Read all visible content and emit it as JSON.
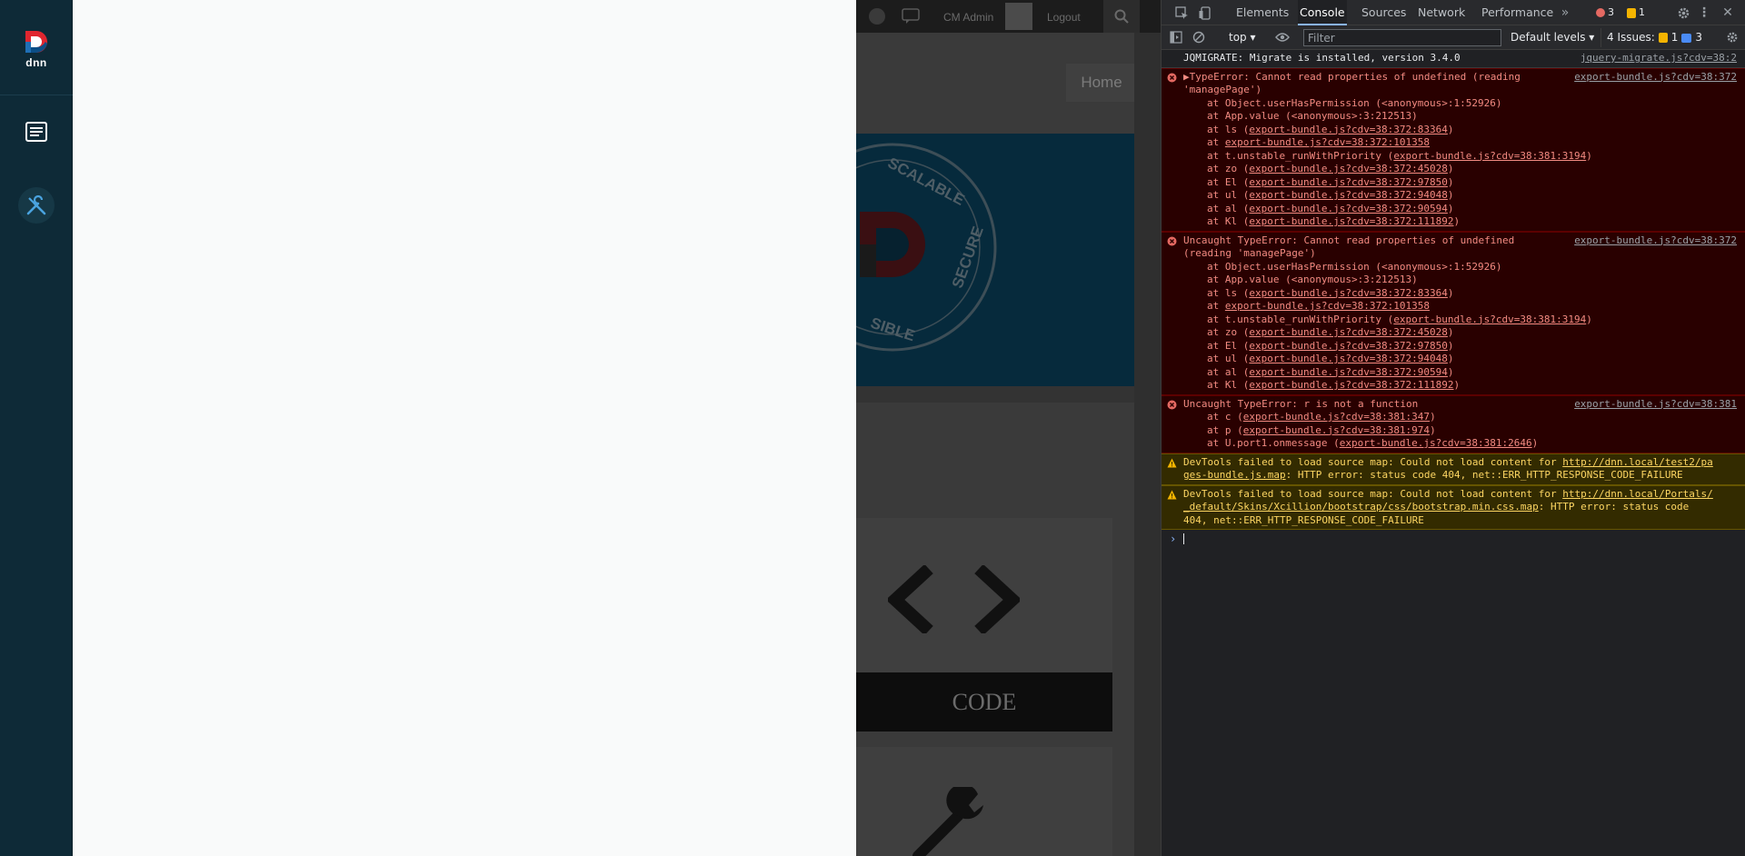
{
  "persona_bar": {
    "logo_text": "dnn",
    "items": [
      {
        "name": "content",
        "icon": "content-list-icon"
      },
      {
        "name": "tools",
        "icon": "wrench-screwdriver-icon"
      }
    ]
  },
  "site": {
    "topbar": {
      "user_label": "CM Admin",
      "logout_label": "Logout"
    },
    "home_label": "Home",
    "hero_words": [
      "SCALABLE",
      "SECURE",
      "SIBLE"
    ],
    "card_label": "CODE"
  },
  "devtools": {
    "tabs": [
      "Elements",
      "Console",
      "Sources",
      "Network",
      "Performance"
    ],
    "active_tab": "Console",
    "error_count": "3",
    "warning_count": "1",
    "toolbar": {
      "context": "top",
      "filter_placeholder": "Filter",
      "levels": "Default levels",
      "issues_label": "4 Issues:",
      "issues_warn": "1",
      "issues_info": "3"
    },
    "messages": [
      {
        "level": "log",
        "text": "JQMIGRATE: Migrate is installed, version 3.4.0",
        "source": "jquery-migrate.js?cdv=38:2"
      },
      {
        "level": "error",
        "text": "▶TypeError: Cannot read properties of undefined (reading\n'managePage')",
        "source": "export-bundle.js?cdv=38:372",
        "frames": [
          {
            "pre": "at Object.userHasPermission (<anonymous>:1:52926)",
            "link": ""
          },
          {
            "pre": "at App.value (<anonymous>:3:212513)",
            "link": ""
          },
          {
            "pre": "at ls (",
            "link": "export-bundle.js?cdv=38:372:83364",
            "post": ")"
          },
          {
            "pre": "at ",
            "link": "export-bundle.js?cdv=38:372:101358",
            "post": ""
          },
          {
            "pre": "at t.unstable_runWithPriority (",
            "link": "export-bundle.js?cdv=38:381:3194",
            "post": ")"
          },
          {
            "pre": "at zo (",
            "link": "export-bundle.js?cdv=38:372:45028",
            "post": ")"
          },
          {
            "pre": "at El (",
            "link": "export-bundle.js?cdv=38:372:97850",
            "post": ")"
          },
          {
            "pre": "at ul (",
            "link": "export-bundle.js?cdv=38:372:94048",
            "post": ")"
          },
          {
            "pre": "at al (",
            "link": "export-bundle.js?cdv=38:372:90594",
            "post": ")"
          },
          {
            "pre": "at Kl (",
            "link": "export-bundle.js?cdv=38:372:111892",
            "post": ")"
          }
        ]
      },
      {
        "level": "error",
        "text": "Uncaught TypeError: Cannot read properties of undefined\n(reading 'managePage')",
        "source": "export-bundle.js?cdv=38:372",
        "frames": [
          {
            "pre": "at Object.userHasPermission (<anonymous>:1:52926)",
            "link": ""
          },
          {
            "pre": "at App.value (<anonymous>:3:212513)",
            "link": ""
          },
          {
            "pre": "at ls (",
            "link": "export-bundle.js?cdv=38:372:83364",
            "post": ")"
          },
          {
            "pre": "at ",
            "link": "export-bundle.js?cdv=38:372:101358",
            "post": ""
          },
          {
            "pre": "at t.unstable_runWithPriority (",
            "link": "export-bundle.js?cdv=38:381:3194",
            "post": ")"
          },
          {
            "pre": "at zo (",
            "link": "export-bundle.js?cdv=38:372:45028",
            "post": ")"
          },
          {
            "pre": "at El (",
            "link": "export-bundle.js?cdv=38:372:97850",
            "post": ")"
          },
          {
            "pre": "at ul (",
            "link": "export-bundle.js?cdv=38:372:94048",
            "post": ")"
          },
          {
            "pre": "at al (",
            "link": "export-bundle.js?cdv=38:372:90594",
            "post": ")"
          },
          {
            "pre": "at Kl (",
            "link": "export-bundle.js?cdv=38:372:111892",
            "post": ")"
          }
        ]
      },
      {
        "level": "error",
        "text": "Uncaught TypeError: r is not a function",
        "source": "export-bundle.js?cdv=38:381",
        "frames": [
          {
            "pre": "at c (",
            "link": "export-bundle.js?cdv=38:381:347",
            "post": ")"
          },
          {
            "pre": "at p (",
            "link": "export-bundle.js?cdv=38:381:974",
            "post": ")"
          },
          {
            "pre": "at U.port1.onmessage (",
            "link": "export-bundle.js?cdv=38:381:2646",
            "post": ")"
          }
        ]
      },
      {
        "level": "warn",
        "pre": "DevTools failed to load source map: Could not load content for ",
        "link": "http://dnn.local/test2/pages-bundle.js.map",
        "post": ": HTTP error: status code 404, net::ERR_HTTP_RESPONSE_CODE_FAILURE"
      },
      {
        "level": "warn",
        "pre": "DevTools failed to load source map: Could not load content for ",
        "link": "http://dnn.local/Portals/_default/Skins/Xcillion/bootstrap/css/bootstrap.min.css.map",
        "post": ": HTTP error: status code 404, net::ERR_HTTP_RESPONSE_CODE_FAILURE"
      }
    ]
  },
  "colors": {
    "persona_bg": "#0e2a37",
    "dnn_red": "#e0262f",
    "dnn_blue": "#1f6fb5",
    "error_bg": "#290000",
    "warn_bg": "#332b00"
  }
}
